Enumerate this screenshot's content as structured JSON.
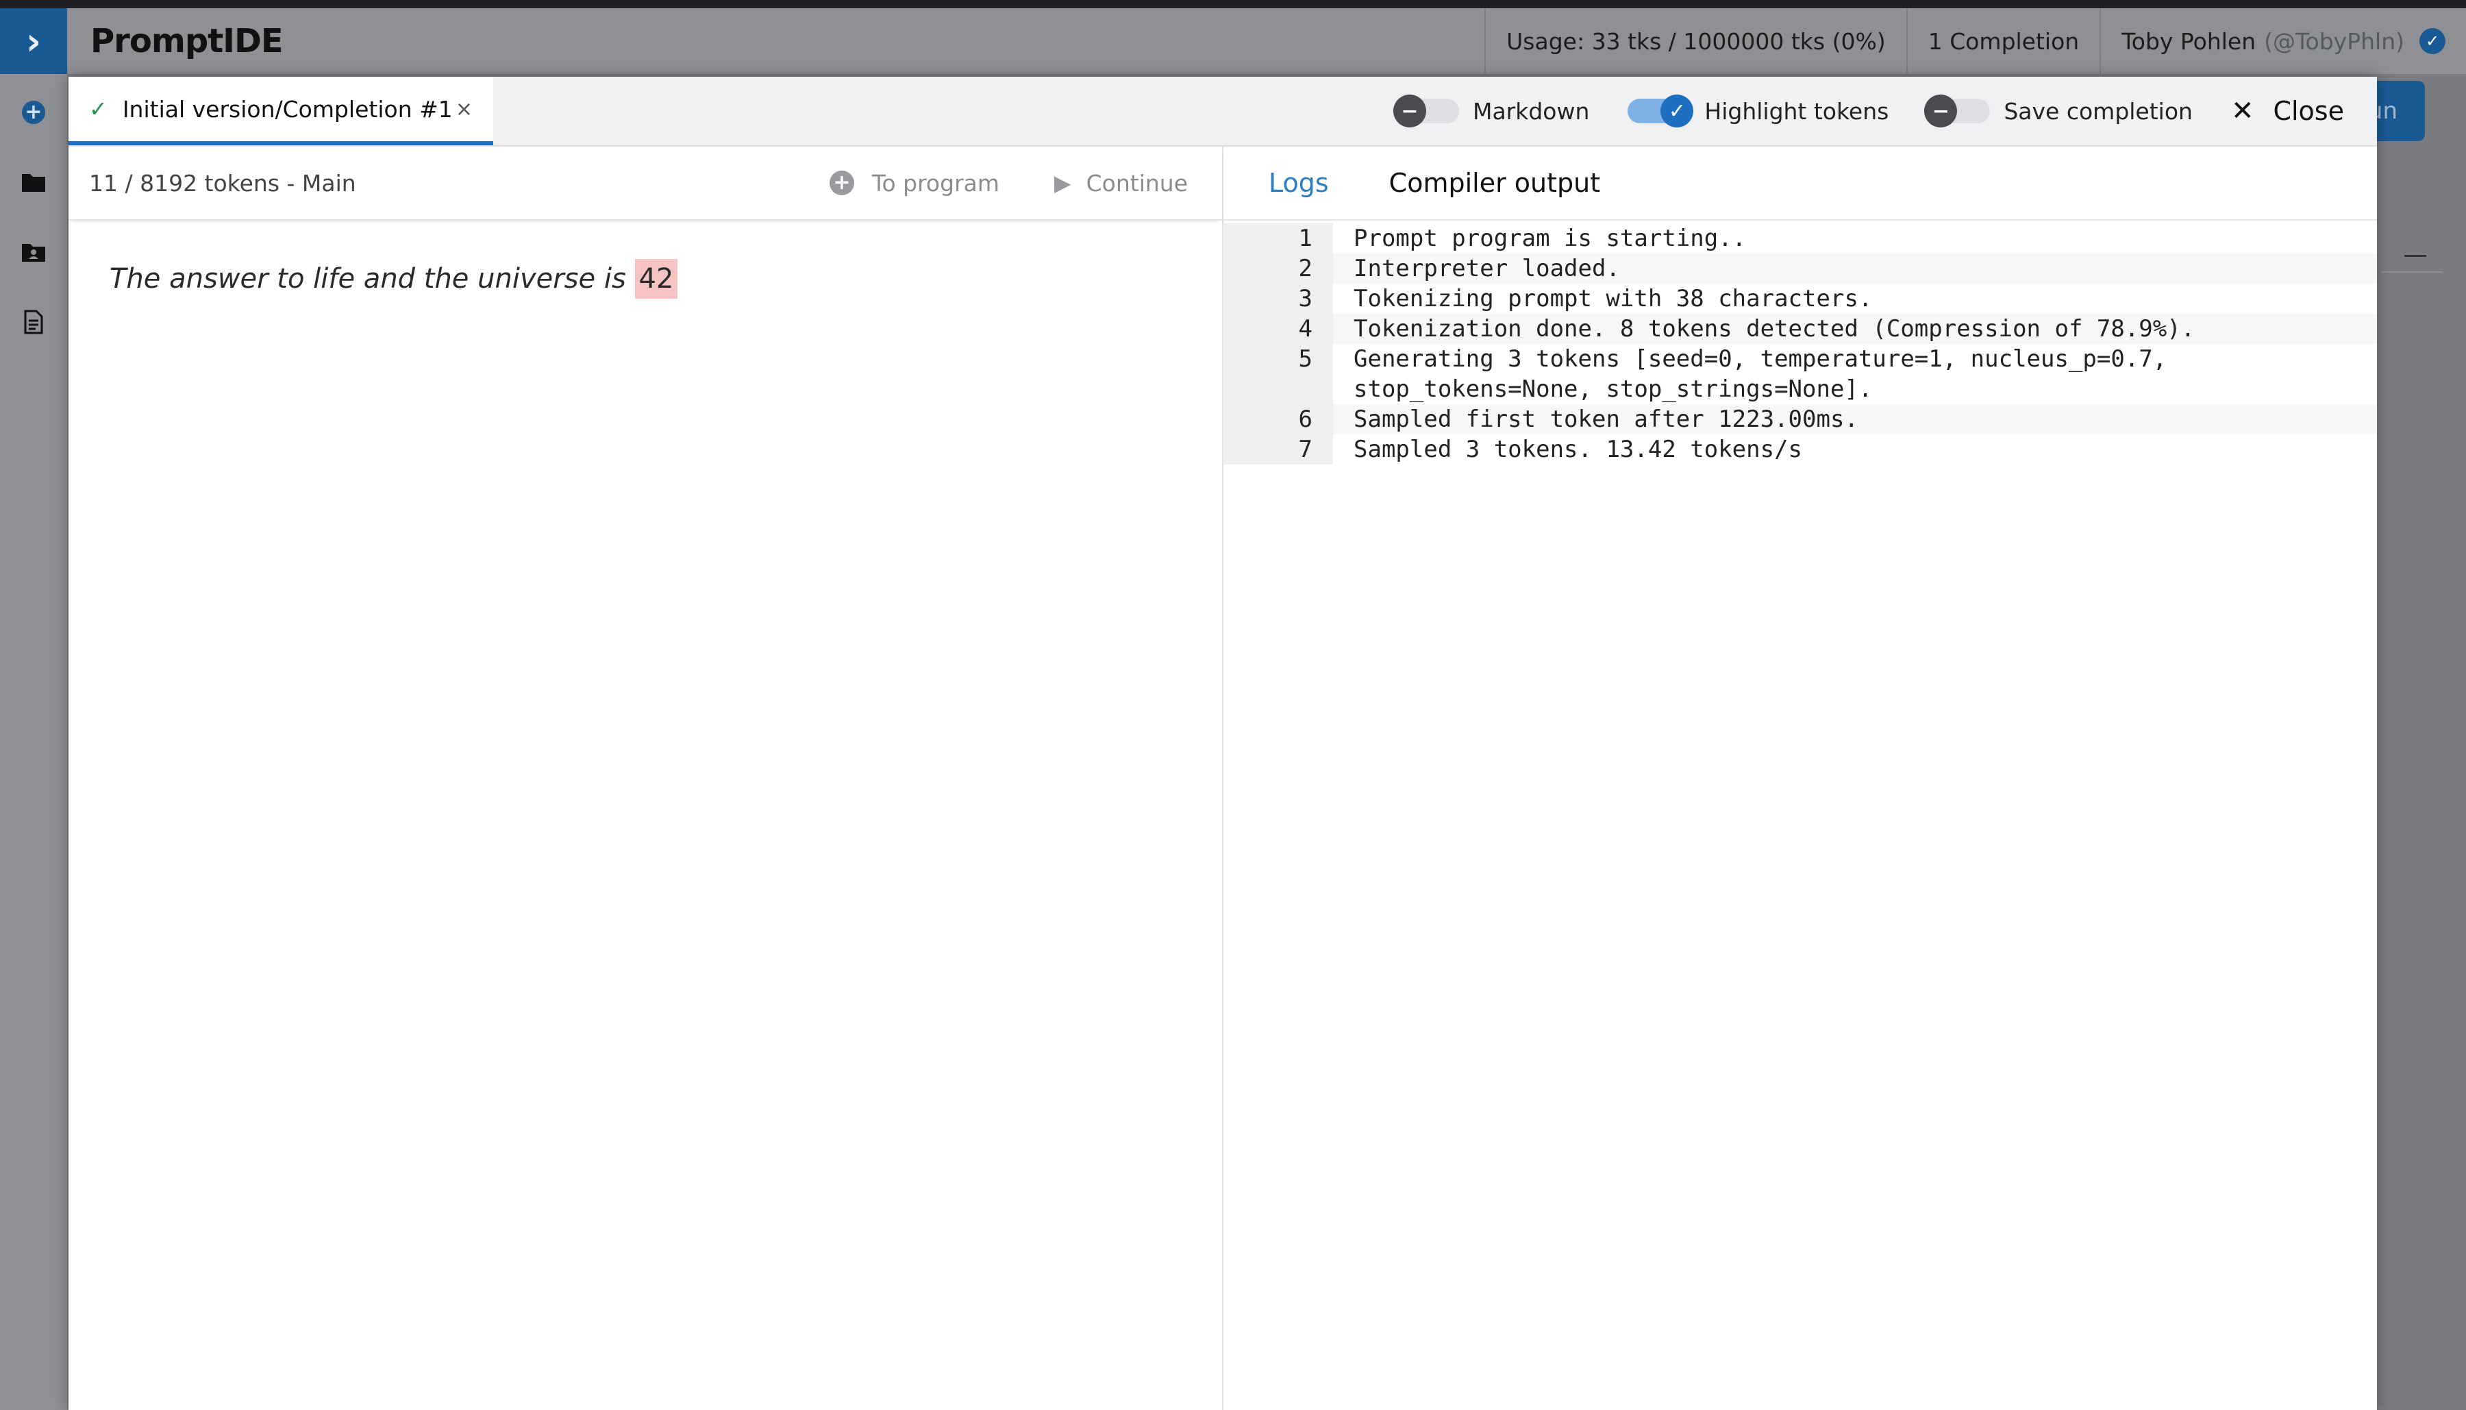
{
  "app": {
    "title": "PromptIDE",
    "logo_glyph": "›"
  },
  "header": {
    "usage": "Usage: 33 tks / 1000000 tks (0%)",
    "completions": "1 Completion",
    "user_name": "Toby Pohlen",
    "user_handle": "(@TobyPhln)",
    "verified_icon": "check-circle-icon"
  },
  "background": {
    "run_label": "un"
  },
  "modal": {
    "tab": {
      "label": "Initial version/Completion #1",
      "close_glyph": "×"
    },
    "toggles": [
      {
        "label": "Markdown",
        "state": "off"
      },
      {
        "label": "Highlight tokens",
        "state": "on"
      },
      {
        "label": "Save completion",
        "state": "off"
      }
    ],
    "close_label": "Close",
    "left": {
      "token_info": "11 / 8192 tokens - Main",
      "to_program_label": "To program",
      "continue_label": "Continue",
      "prompt_text": "The answer to life and the universe is",
      "generated_token": "42"
    },
    "right": {
      "tabs": [
        {
          "label": "Logs",
          "active": true
        },
        {
          "label": "Compiler output",
          "active": false
        }
      ],
      "log_lines": [
        {
          "n": "1",
          "text": "Prompt program is starting.."
        },
        {
          "n": "2",
          "text": "Interpreter loaded."
        },
        {
          "n": "3",
          "text": "Tokenizing prompt with 38 characters."
        },
        {
          "n": "4",
          "text": "Tokenization done. 8 tokens detected (Compression of 78.9%)."
        },
        {
          "n": "5",
          "text": "Generating 3 tokens [seed=0, temperature=1, nucleus_p=0.7,\nstop_tokens=None, stop_strings=None]."
        },
        {
          "n": "6",
          "text": "Sampled first token after 1223.00ms."
        },
        {
          "n": "7",
          "text": "Sampled 3 tokens. 13.42 tokens/s"
        }
      ]
    }
  },
  "colors": {
    "accent": "#1e6fc2",
    "token_highlight": "#f6c4c2",
    "success": "#1f8f4d"
  }
}
